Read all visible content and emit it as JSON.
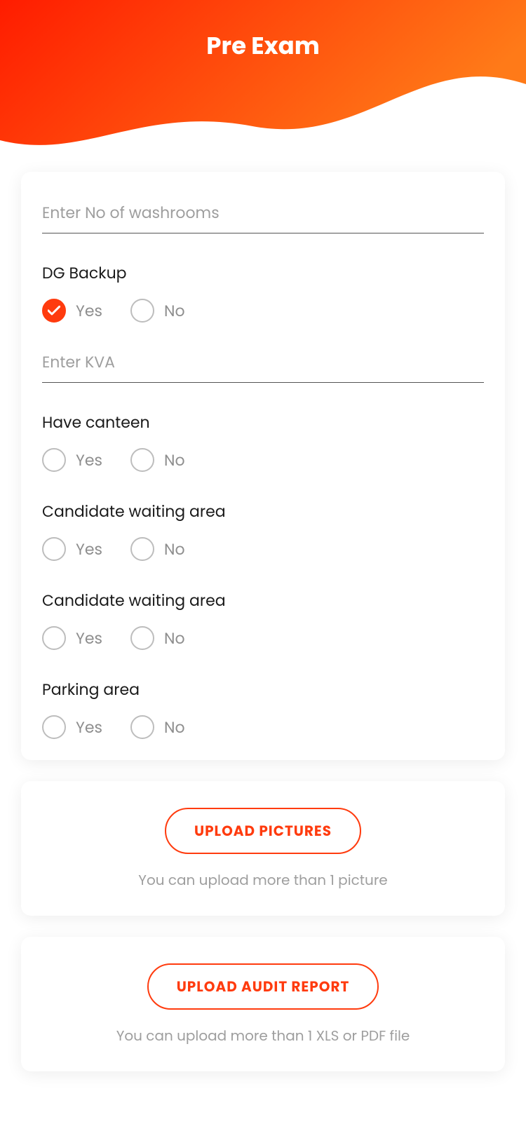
{
  "header": {
    "title": "Pre Exam"
  },
  "form": {
    "washrooms_placeholder": "Enter No of washrooms",
    "washrooms_value": "",
    "dg_backup": {
      "label": "DG Backup",
      "yes": "Yes",
      "no": "No",
      "selected": "yes",
      "kva_placeholder": "Enter KVA",
      "kva_value": ""
    },
    "canteen": {
      "label": "Have canteen",
      "yes": "Yes",
      "no": "No"
    },
    "waiting1": {
      "label": "Candidate waiting area",
      "yes": "Yes",
      "no": "No"
    },
    "waiting2": {
      "label": "Candidate waiting area",
      "yes": "Yes",
      "no": "No"
    },
    "parking": {
      "label": "Parking area",
      "yes": "Yes",
      "no": "No"
    }
  },
  "upload_pictures": {
    "button": "UPLOAD PICTURES",
    "hint": "You can upload more than 1 picture"
  },
  "upload_report": {
    "button": "UPLOAD AUDIT REPORT",
    "hint": "You can upload more than 1 XLS or PDF file"
  }
}
